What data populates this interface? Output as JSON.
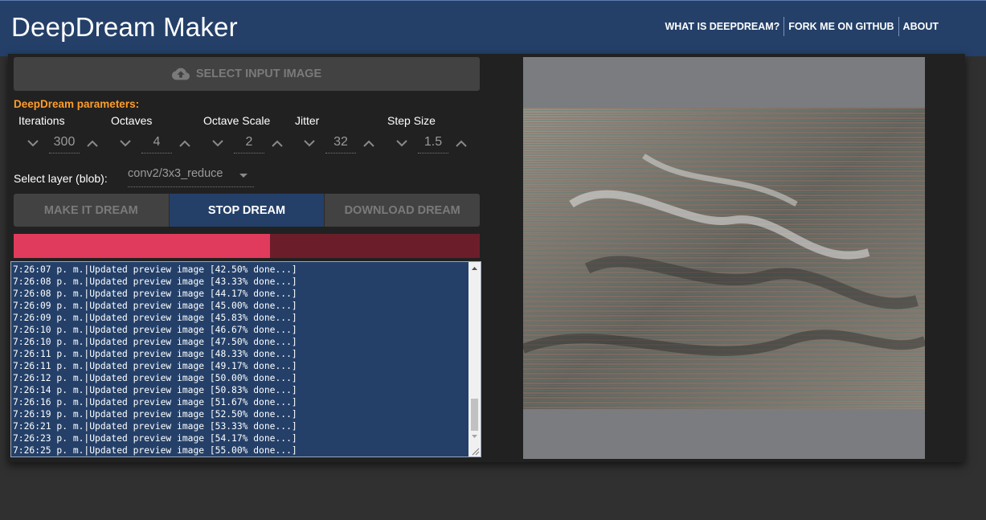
{
  "app": {
    "title": "DeepDream Maker",
    "nav": [
      "WHAT IS DEEPDREAM?",
      "FORK ME ON GITHUB",
      "ABOUT"
    ]
  },
  "controls": {
    "select_input_label": "SELECT INPUT IMAGE",
    "params_title": "DeepDream parameters:",
    "params": [
      {
        "label": "Iterations",
        "value": "300"
      },
      {
        "label": "Octaves",
        "value": "4"
      },
      {
        "label": "Octave Scale",
        "value": "2"
      },
      {
        "label": "Jitter",
        "value": "32"
      },
      {
        "label": "Step Size",
        "value": "1.5"
      }
    ],
    "layer_label": "Select layer (blob):",
    "layer_value": "conv2/3x3_reduce",
    "buttons": {
      "make": "MAKE IT DREAM",
      "stop": "STOP DREAM",
      "download": "DOWNLOAD DREAM"
    }
  },
  "progress": {
    "percent": 55.0
  },
  "log": [
    "7:26:07 p. m.|Updated preview image [42.50% done...]",
    "7:26:08 p. m.|Updated preview image [43.33% done...]",
    "7:26:08 p. m.|Updated preview image [44.17% done...]",
    "7:26:09 p. m.|Updated preview image [45.00% done...]",
    "7:26:09 p. m.|Updated preview image [45.83% done...]",
    "7:26:10 p. m.|Updated preview image [46.67% done...]",
    "7:26:10 p. m.|Updated preview image [47.50% done...]",
    "7:26:11 p. m.|Updated preview image [48.33% done...]",
    "7:26:11 p. m.|Updated preview image [49.17% done...]",
    "7:26:12 p. m.|Updated preview image [50.00% done...]",
    "7:26:14 p. m.|Updated preview image [50.83% done...]",
    "7:26:16 p. m.|Updated preview image [51.67% done...]",
    "7:26:19 p. m.|Updated preview image [52.50% done...]",
    "7:26:21 p. m.|Updated preview image [53.33% done...]",
    "7:26:23 p. m.|Updated preview image [54.17% done...]",
    "7:26:25 p. m.|Updated preview image [55.00% done...]"
  ],
  "colors": {
    "appbar": "#244069",
    "accent_orange": "#ff9d2a",
    "progress_fill": "#e03a5c",
    "progress_track": "#6b1e2a"
  },
  "icons": {
    "upload": "cloud-upload-icon",
    "stepper_down": "chevron-down-icon",
    "stepper_up": "chevron-up-icon",
    "layer_caret": "caret-down-icon"
  }
}
